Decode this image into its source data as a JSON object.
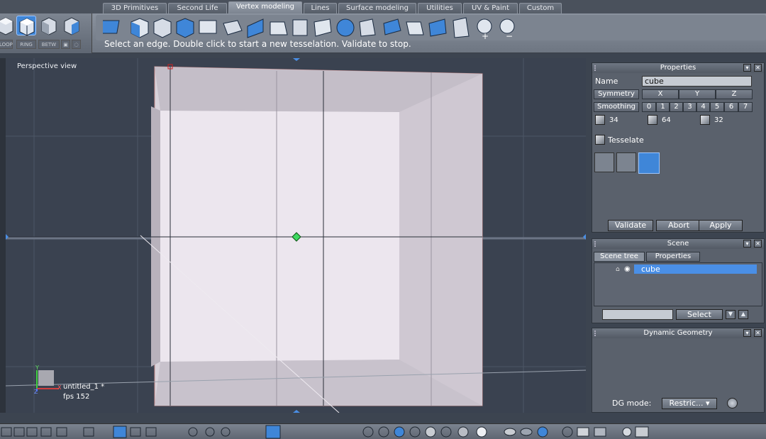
{
  "tabs": [
    "3D Primitives",
    "Second Life",
    "Vertex modeling",
    "Lines",
    "Surface modeling",
    "Utilities",
    "UV & Paint",
    "Custom"
  ],
  "active_tab": "Vertex modeling",
  "left_tools": {
    "loop": "LOOP",
    "ring": "RING",
    "betw": "BETW"
  },
  "status_message": "Select an edge. Double click to start a new tesselation. Validate to stop.",
  "viewport": {
    "label": "Perspective view",
    "document_name": "untitled_1 *",
    "fps": "fps 152",
    "axis_y": "Y",
    "axis_z": "Z",
    "axis_x": "X"
  },
  "properties": {
    "title": "Properties",
    "name_label": "Name",
    "name_value": "cube",
    "symmetry_label": "Symmetry",
    "symmetry_axes": [
      "X",
      "Y",
      "Z"
    ],
    "smoothing_label": "Smoothing",
    "smoothing_levels": [
      "0",
      "1",
      "2",
      "3",
      "4",
      "5",
      "6",
      "7"
    ],
    "counts": [
      "34",
      "64",
      "32"
    ],
    "tool_name": "Tesselate",
    "validate": "Validate",
    "abort": "Abort",
    "apply": "Apply"
  },
  "scene": {
    "title": "Scene",
    "tab_tree": "Scene tree",
    "tab_properties": "Properties",
    "item": "cube",
    "select_button": "Select"
  },
  "dynamic_geometry": {
    "title": "Dynamic Geometry",
    "mode_label": "DG mode:",
    "mode_value": "Restric..."
  },
  "colors": {
    "accent": "#3f86d8",
    "selection": "#4a8fe6",
    "cube_edge": "#d08080"
  }
}
